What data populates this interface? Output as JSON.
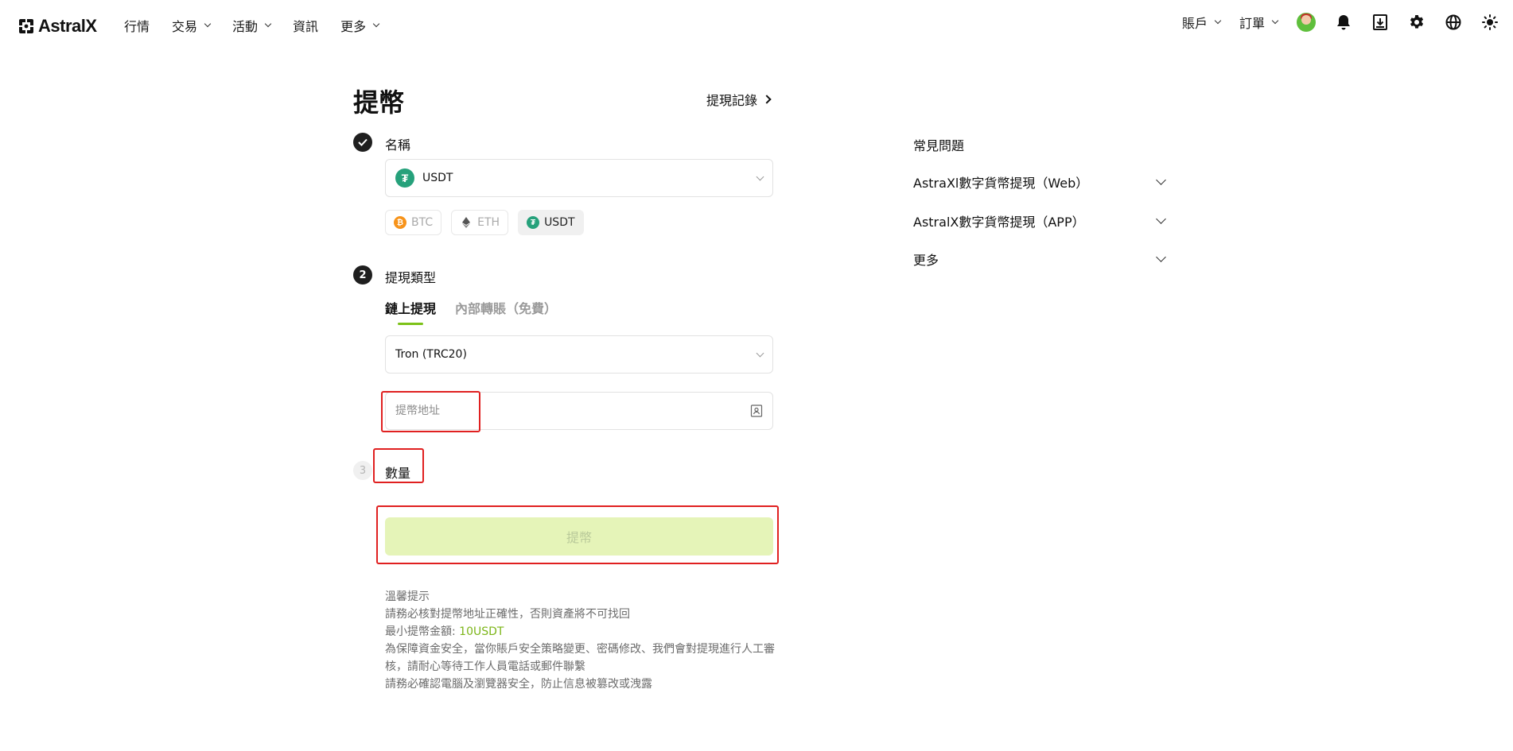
{
  "brand": {
    "name": "AstralX"
  },
  "nav": {
    "items": [
      {
        "label": "行情",
        "has_dropdown": false
      },
      {
        "label": "交易",
        "has_dropdown": true
      },
      {
        "label": "活動",
        "has_dropdown": true
      },
      {
        "label": "資訊",
        "has_dropdown": false
      },
      {
        "label": "更多",
        "has_dropdown": true
      }
    ],
    "right": {
      "account": "賬戶",
      "orders": "訂單"
    },
    "icons": [
      "avatar",
      "bell-icon",
      "download-icon",
      "gear-icon",
      "globe-icon",
      "sun-icon"
    ]
  },
  "page": {
    "title": "提幣",
    "history_link": "提現記錄"
  },
  "steps": [
    {
      "number": "1",
      "label": "名稱",
      "state": "done"
    },
    {
      "number": "2",
      "label": "提現類型",
      "state": "active"
    },
    {
      "number": "3",
      "label": "數量",
      "state": "pending"
    }
  ],
  "coin_select": {
    "value": "USDT",
    "icon": "tether-icon"
  },
  "quick_coins": [
    {
      "label": "BTC",
      "icon": "bitcoin-icon",
      "color": "#f7931a",
      "selected": false
    },
    {
      "label": "ETH",
      "icon": "ethereum-icon",
      "color": "#627eea",
      "selected": false
    },
    {
      "label": "USDT",
      "icon": "tether-icon",
      "color": "#26a17b",
      "selected": true
    }
  ],
  "withdraw_tabs": [
    {
      "label": "鏈上提現",
      "active": true
    },
    {
      "label": "內部轉賬（免費）",
      "active": false
    }
  ],
  "network_select": {
    "value": "Tron (TRC20)"
  },
  "address_input": {
    "value": "",
    "placeholder": "提幣地址"
  },
  "submit": {
    "label": "提幣",
    "enabled": false
  },
  "tips": {
    "title": "溫馨提示",
    "lines": [
      "請務必核對提幣地址正確性，否則資產將不可找回",
      "為保障資金安全，當你賬戶安全策略變更、密碼修改、我們會對提現進行人工審核，請耐心等待工作人員電話或郵件聯繫",
      "請務必確認電腦及瀏覽器安全，防止信息被篡改或洩露"
    ],
    "min_label": "最小提幣金額:",
    "min_value": "10USDT"
  },
  "faq": {
    "title": "常見問題",
    "items": [
      {
        "label": "AstraXl數字貨幣提現（Web）"
      },
      {
        "label": "AstralX數字貨幣提現（APP）"
      },
      {
        "label": "更多"
      }
    ]
  },
  "colors": {
    "accent": "#7cc219",
    "button_disabled_bg": "#e5f4b8",
    "highlight_box": "#e02020",
    "tether": "#26a17b",
    "bitcoin": "#f7931a"
  }
}
